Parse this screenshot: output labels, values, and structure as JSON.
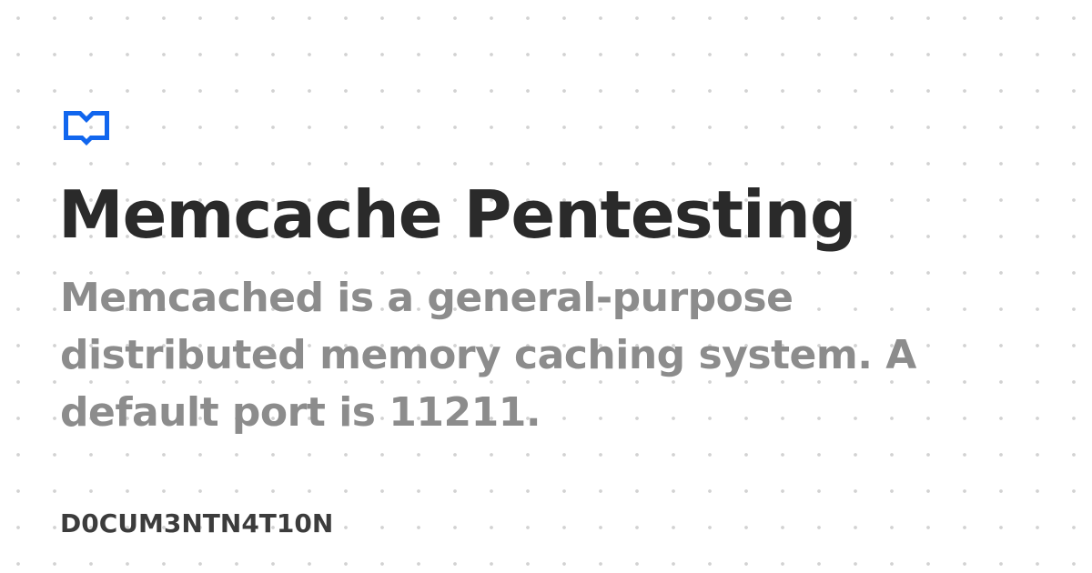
{
  "logo": {
    "icon": "book-chat-icon",
    "color": "#1166ee"
  },
  "title": "Memcache Pentesting",
  "description": "Memcached is a general-purpose distributed memory caching system. A default port is 11211.",
  "site_name": "D0CUM3NTN4T10N",
  "colors": {
    "title": "#2a2a2a",
    "description": "#8c8c8c",
    "site_name": "#3c3c3c",
    "background_dots": "#d2d2d2"
  }
}
